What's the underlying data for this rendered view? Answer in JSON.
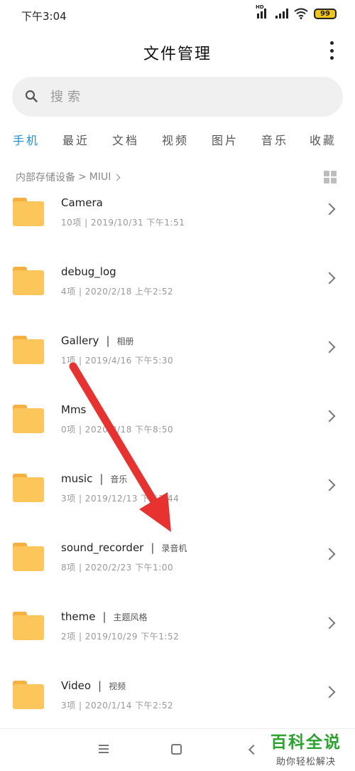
{
  "status_bar": {
    "time": "下午3:04",
    "battery": "99",
    "hd_label": "HD"
  },
  "header": {
    "title": "文件管理"
  },
  "search": {
    "placeholder": "搜索"
  },
  "tabs": [
    {
      "label": "手机",
      "active": true
    },
    {
      "label": "最近"
    },
    {
      "label": "文档"
    },
    {
      "label": "视频"
    },
    {
      "label": "图片"
    },
    {
      "label": "音乐"
    },
    {
      "label": "收藏"
    }
  ],
  "breadcrumb": {
    "root": "内部存储设备",
    "separator": ">",
    "current": "MIUI"
  },
  "folders": [
    {
      "name": "Camera",
      "alias": "",
      "meta": "10项 | 2019/10/31 下午1:51"
    },
    {
      "name": "debug_log",
      "alias": "",
      "meta": "4项 | 2020/2/18 上午2:52"
    },
    {
      "name": "Gallery",
      "alias": "相册",
      "meta": "1项 | 2019/4/16 下午5:30"
    },
    {
      "name": "Mms",
      "alias": "",
      "meta": "0项 | 2020/2/18 下午8:50"
    },
    {
      "name": "music",
      "alias": "音乐",
      "meta": "3项 | 2019/12/13 下午2:44"
    },
    {
      "name": "sound_recorder",
      "alias": "录音机",
      "meta": "8项 | 2020/2/23 下午1:00"
    },
    {
      "name": "theme",
      "alias": "主题风格",
      "meta": "2项 | 2019/10/29 下午1:52"
    },
    {
      "name": "Video",
      "alias": "视频",
      "meta": "3项 | 2020/1/14 下午2:52"
    }
  ],
  "watermark": {
    "title": "百科全说",
    "subtitle": "助你轻松解决"
  },
  "colors": {
    "accent": "#1d8fe1",
    "folder": "#fcc65a",
    "arrow": "#e8322f",
    "watermark": "#29a52d"
  }
}
